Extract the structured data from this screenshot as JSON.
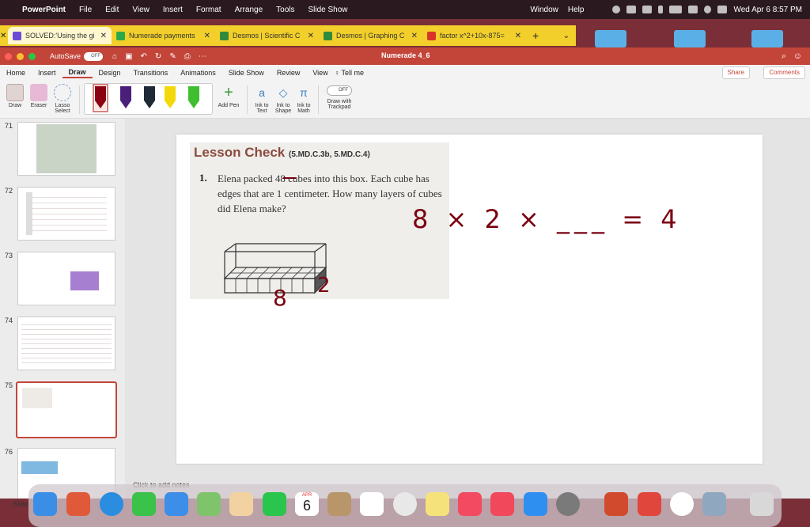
{
  "menubar": {
    "app": "PowerPoint",
    "items": [
      "File",
      "Edit",
      "View",
      "Insert",
      "Format",
      "Arrange",
      "Tools",
      "Slide Show"
    ],
    "right_items": [
      "Window",
      "Help"
    ],
    "clock": "Wed Apr 6  8:57 PM"
  },
  "browser_tabs": [
    {
      "title": "SOLVED:'Using the gi",
      "color": "#6b4bd8"
    },
    {
      "title": "Numerade payments",
      "color": "#2aa84a"
    },
    {
      "title": "Desmos | Scientific C",
      "color": "#2f8a3c"
    },
    {
      "title": "Desmos | Graphing C",
      "color": "#2f8a3c"
    },
    {
      "title": "factor x^2+10x-875=",
      "color": "#d8352a"
    }
  ],
  "window": {
    "autosave_label": "AutoSave",
    "autosave_state": "OFF",
    "doc_title": "Numerade 4_6"
  },
  "ribbon_tabs": [
    "Home",
    "Insert",
    "Draw",
    "Design",
    "Transitions",
    "Animations",
    "Slide Show",
    "Review",
    "View",
    "Tell me"
  ],
  "ribbon_active_tab": "Draw",
  "share_label": "Share",
  "comments_label": "Comments",
  "ribbon": {
    "draw": "Draw",
    "eraser": "Eraser",
    "lasso": "Lasso",
    "lasso2": "Select",
    "add_pen": "Add Pen",
    "ink_text_1": "Ink to",
    "ink_text_2": "Text",
    "ink_shape_1": "Ink to",
    "ink_shape_2": "Shape",
    "ink_math_1": "Ink to",
    "ink_math_2": "Math",
    "trackpad_1": "Draw with",
    "trackpad_2": "Trackpad",
    "trackpad_state": "OFF"
  },
  "pen_colors": [
    "#8a0012",
    "#4a1f7a",
    "#1f2a36",
    "#f4d90a",
    "#3fbf2f"
  ],
  "thumb_numbers": [
    "71",
    "72",
    "73",
    "74",
    "75",
    "76"
  ],
  "slide": {
    "lesson_title": "Lesson Check",
    "standards": "(5.MD.C.3b, 5.MD.C.4)",
    "problem_number": "1.",
    "problem_text": "Elena packed 48 cubes into this box. Each cube has edges that are 1 centimeter. How many layers of cubes did Elena make?",
    "handwriting": {
      "equation": "8 × 2 × ___ = 4",
      "label_8": "8",
      "label_2": "2"
    }
  },
  "notes_placeholder": "Click to add notes",
  "slide_label": "Slide",
  "dock_apps": [
    "Finder",
    "Launchpad",
    "Safari",
    "Messages",
    "Mail",
    "Maps",
    "Photos",
    "FaceTime",
    "Calendar",
    "Contacts",
    "Reminders",
    "Chrome",
    "Notes",
    "Music",
    "News",
    "App Store",
    "System Preferences",
    "PowerPoint",
    "Mail App",
    "Webex",
    "Preview",
    "Trash"
  ],
  "calendar_day": "6",
  "calendar_month": "APR"
}
